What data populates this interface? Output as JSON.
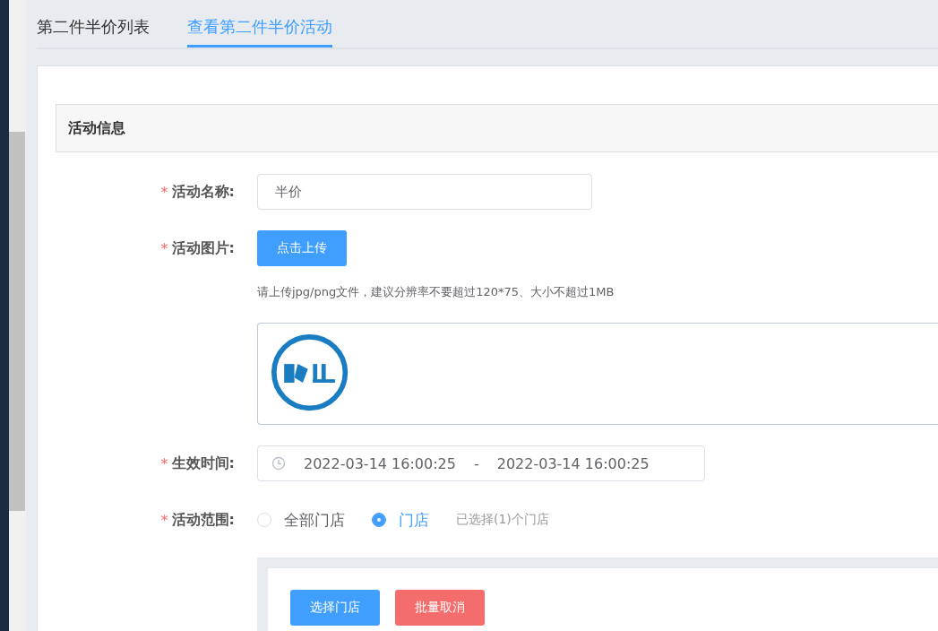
{
  "tabs": [
    {
      "label": "第二件半价列表",
      "selected": false
    },
    {
      "label": "查看第二件半价活动",
      "selected": true
    }
  ],
  "section_title": "活动信息",
  "form": [
    {
      "kind": "text",
      "mark": "*",
      "label": "活动名称:",
      "value": "半价"
    },
    {
      "kind": "upload",
      "mark": "*",
      "label": "活动图片:",
      "button": "点击上传",
      "hint": "请上传jpg/png文件，建议分辨率不要超过120*75、大小不超过1MB"
    },
    {
      "kind": "daterange",
      "mark": "*",
      "label": "生效时间:",
      "start": "2022-03-14 16:00:25",
      "separator": "-",
      "end": "2022-03-14 16:00:25"
    },
    {
      "kind": "radio",
      "mark": "*",
      "label": "活动范围:",
      "options": [
        {
          "label": "全部门店",
          "selected": false
        },
        {
          "label": "门店",
          "selected": true
        }
      ],
      "note": "已选择(1)个门店"
    }
  ],
  "store_actions": [
    {
      "label": "选择门店",
      "kind": "primary"
    },
    {
      "label": "批量取消",
      "kind": "danger"
    }
  ]
}
